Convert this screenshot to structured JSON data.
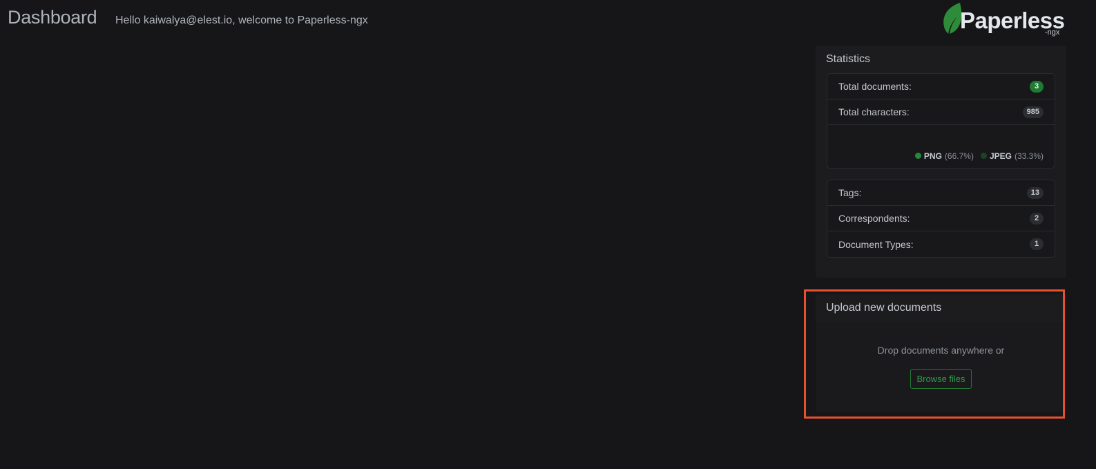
{
  "header": {
    "title": "Dashboard",
    "welcome": "Hello kaiwalya@elest.io, welcome to Paperless-ngx"
  },
  "logo": {
    "name": "Paperless",
    "sub": "-ngx",
    "icon": "leaf-icon",
    "color": "#2e8b3a"
  },
  "statistics": {
    "title": "Statistics",
    "documents": [
      {
        "label": "Total documents:",
        "value": "3",
        "accent": true
      },
      {
        "label": "Total characters:",
        "value": "985",
        "accent": false
      }
    ],
    "file_types": [
      {
        "name": "PNG",
        "pct_label": "(66.7%)",
        "fraction": 0.667,
        "color": "#248a3b"
      },
      {
        "name": "JPEG",
        "pct_label": "(33.3%)",
        "fraction": 0.333,
        "color": "#1e4226"
      }
    ],
    "metadata": [
      {
        "label": "Tags:",
        "value": "13"
      },
      {
        "label": "Correspondents:",
        "value": "2"
      },
      {
        "label": "Document Types:",
        "value": "1"
      }
    ]
  },
  "upload": {
    "title": "Upload new documents",
    "drop_text": "Drop documents anywhere or",
    "browse_label": "Browse files"
  },
  "colors": {
    "background": "#161618",
    "accent": "#1f7a33",
    "highlight": "#e8502f"
  }
}
